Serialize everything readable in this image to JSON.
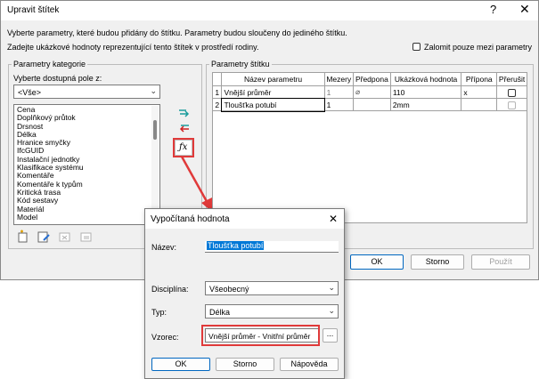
{
  "main_dialog": {
    "title": "Upravit štítek",
    "help_label": "?",
    "close_label": "✕",
    "description_line1": "Vyberte parametry, které budou přidány do štítku. Parametry budou sloučeny do jediného štítku.",
    "description_line2": "Zadejte ukázkové hodnoty reprezentující tento štítek v prostředí rodiny.",
    "wrap_checkbox_label": "Zalomit pouze mezi parametry",
    "category_group": {
      "title": "Parametry kategorie",
      "select_label": "Vyberte dostupná pole z:",
      "select_value": "<Vše>",
      "list_items": [
        "Cena",
        "Doplňkový průtok",
        "Drsnost",
        "Délka",
        "Hranice smyčky",
        "IfcGUID",
        "Instalační jednotky",
        "Klasifikace systému",
        "Komentáře",
        "Komentáře k typům",
        "Kritická trasa",
        "Kód sestavy",
        "Materiál",
        "Model"
      ]
    },
    "label_group": {
      "title": "Parametry štítku",
      "columns": [
        "",
        "Název parametru",
        "Mezery",
        "Předpona",
        "Ukázková hodnota",
        "Přípona",
        "Přerušit"
      ],
      "rows": [
        {
          "num": "1",
          "name": "Vnější průměr",
          "spaces": "1",
          "prefix": "⌀",
          "sample": "110",
          "suffix": "x",
          "break": false
        },
        {
          "num": "2",
          "name": "Tloušťka potubí",
          "spaces": "1",
          "prefix": "",
          "sample": "2mm",
          "suffix": "",
          "break": false
        }
      ]
    },
    "buttons": {
      "ok": "OK",
      "cancel": "Storno",
      "apply": "Použít"
    }
  },
  "calc_dialog": {
    "title": "Vypočítaná hodnota",
    "close_label": "✕",
    "name_label": "Název:",
    "name_value": "Tloušťka potubí",
    "discipline_label": "Disciplína:",
    "discipline_value": "Všeobecný",
    "type_label": "Typ:",
    "type_value": "Délka",
    "formula_label": "Vzorec:",
    "formula_value": "Vnější průměr - Vnitřní průměr",
    "formula_browse": "...",
    "buttons": {
      "ok": "OK",
      "cancel": "Storno",
      "help": "Nápověda"
    }
  },
  "icons": {
    "add_param": "add-parameter-icon",
    "remove_param": "remove-parameter-icon",
    "calculated": "fx-icon",
    "new_param": "new-parameter-icon",
    "edit_param": "edit-parameter-icon",
    "delete_param": "delete-parameter-icon",
    "sort": "sort-icon"
  },
  "colors": {
    "highlight": "#e03a3a",
    "accent": "#0067c0",
    "selection": "#0078d7"
  }
}
